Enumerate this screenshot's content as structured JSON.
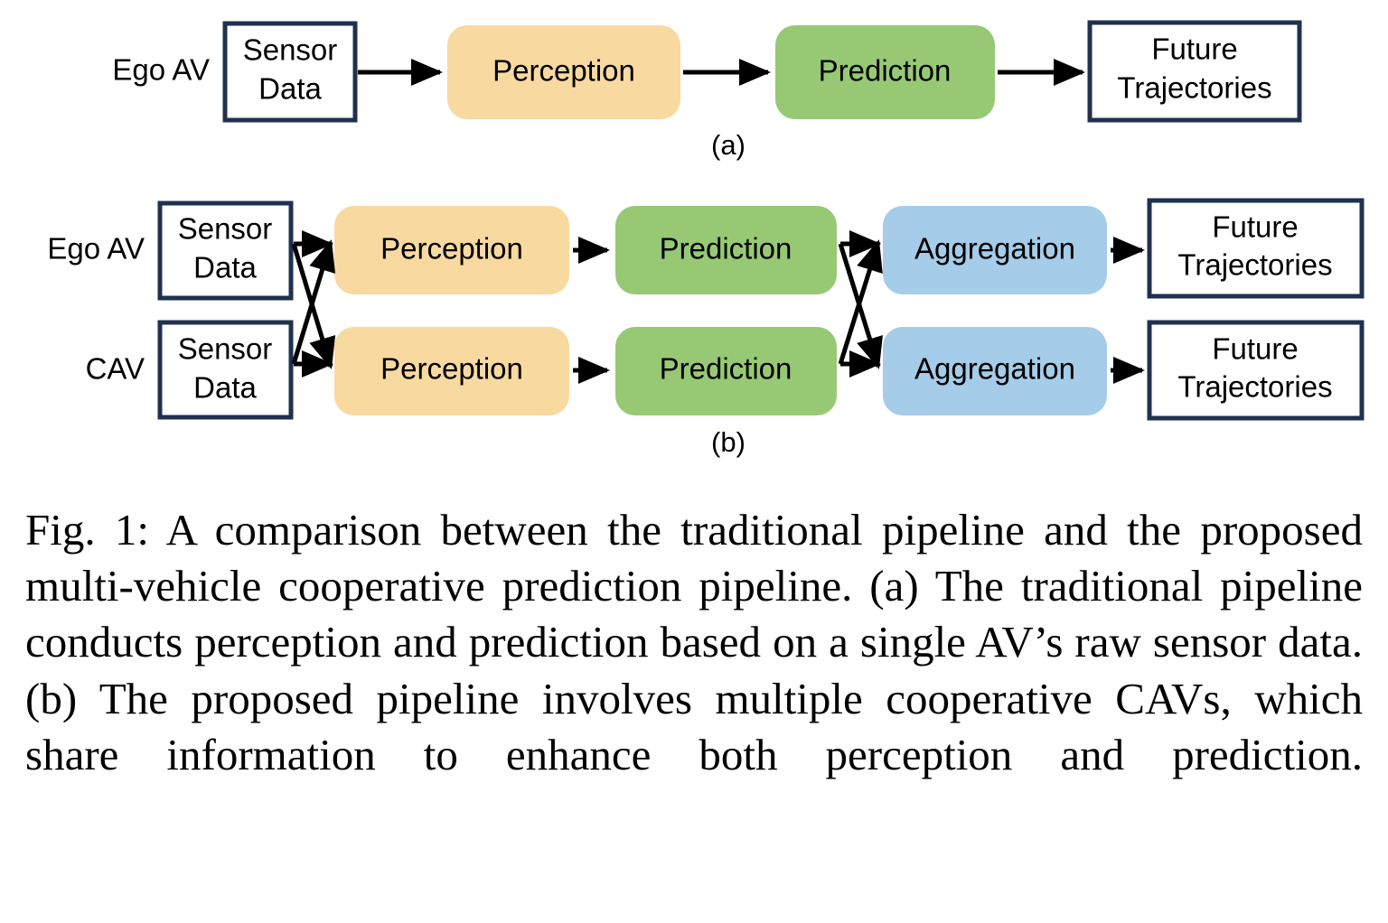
{
  "figure": {
    "id": "Fig. 1",
    "caption": "Fig. 1: A comparison between the traditional pipeline and the proposed multi-vehicle cooperative prediction pipeline. (a) The traditional pipeline conducts perception and prediction based on a single AV’s raw sensor data. (b) The proposed pipeline involves multiple cooperative CAVs, which share information to enhance both perception and prediction."
  },
  "colors": {
    "perception": "#f8d9a0",
    "prediction": "#97c975",
    "aggregation": "#a5cce8",
    "box_border": "#20304f",
    "box_fill": "#ffffff",
    "arrow": "#000000",
    "background": "#ffffff"
  },
  "panels": [
    {
      "key": "a",
      "label": "(a)",
      "rows": [
        {
          "key": "ego-av",
          "row_label": "Ego AV",
          "nodes": [
            {
              "key": "sensor-data",
              "label_line1": "Sensor",
              "label_line2": "Data",
              "style": "plain"
            },
            {
              "key": "perception",
              "label_line1": "Perception",
              "label_line2": "",
              "style": "perception"
            },
            {
              "key": "prediction",
              "label_line1": "Prediction",
              "label_line2": "",
              "style": "prediction"
            },
            {
              "key": "future-trajectories",
              "label_line1": "Future",
              "label_line2": "Trajectories",
              "style": "plain"
            }
          ]
        }
      ]
    },
    {
      "key": "b",
      "label": "(b)",
      "rows": [
        {
          "key": "ego-av",
          "row_label": "Ego AV",
          "nodes": [
            {
              "key": "sensor-data",
              "label_line1": "Sensor",
              "label_line2": "Data",
              "style": "plain"
            },
            {
              "key": "perception",
              "label_line1": "Perception",
              "label_line2": "",
              "style": "perception"
            },
            {
              "key": "prediction",
              "label_line1": "Prediction",
              "label_line2": "",
              "style": "prediction"
            },
            {
              "key": "aggregation",
              "label_line1": "Aggregation",
              "label_line2": "",
              "style": "aggregation"
            },
            {
              "key": "future-trajectories",
              "label_line1": "Future",
              "label_line2": "Trajectories",
              "style": "plain"
            }
          ]
        },
        {
          "key": "cav",
          "row_label": "CAV",
          "nodes": [
            {
              "key": "sensor-data",
              "label_line1": "Sensor",
              "label_line2": "Data",
              "style": "plain"
            },
            {
              "key": "perception",
              "label_line1": "Perception",
              "label_line2": "",
              "style": "perception"
            },
            {
              "key": "prediction",
              "label_line1": "Prediction",
              "label_line2": "",
              "style": "prediction"
            },
            {
              "key": "aggregation",
              "label_line1": "Aggregation",
              "label_line2": "",
              "style": "aggregation"
            },
            {
              "key": "future-trajectories",
              "label_line1": "Future",
              "label_line2": "Trajectories",
              "style": "plain"
            }
          ]
        }
      ]
    }
  ]
}
